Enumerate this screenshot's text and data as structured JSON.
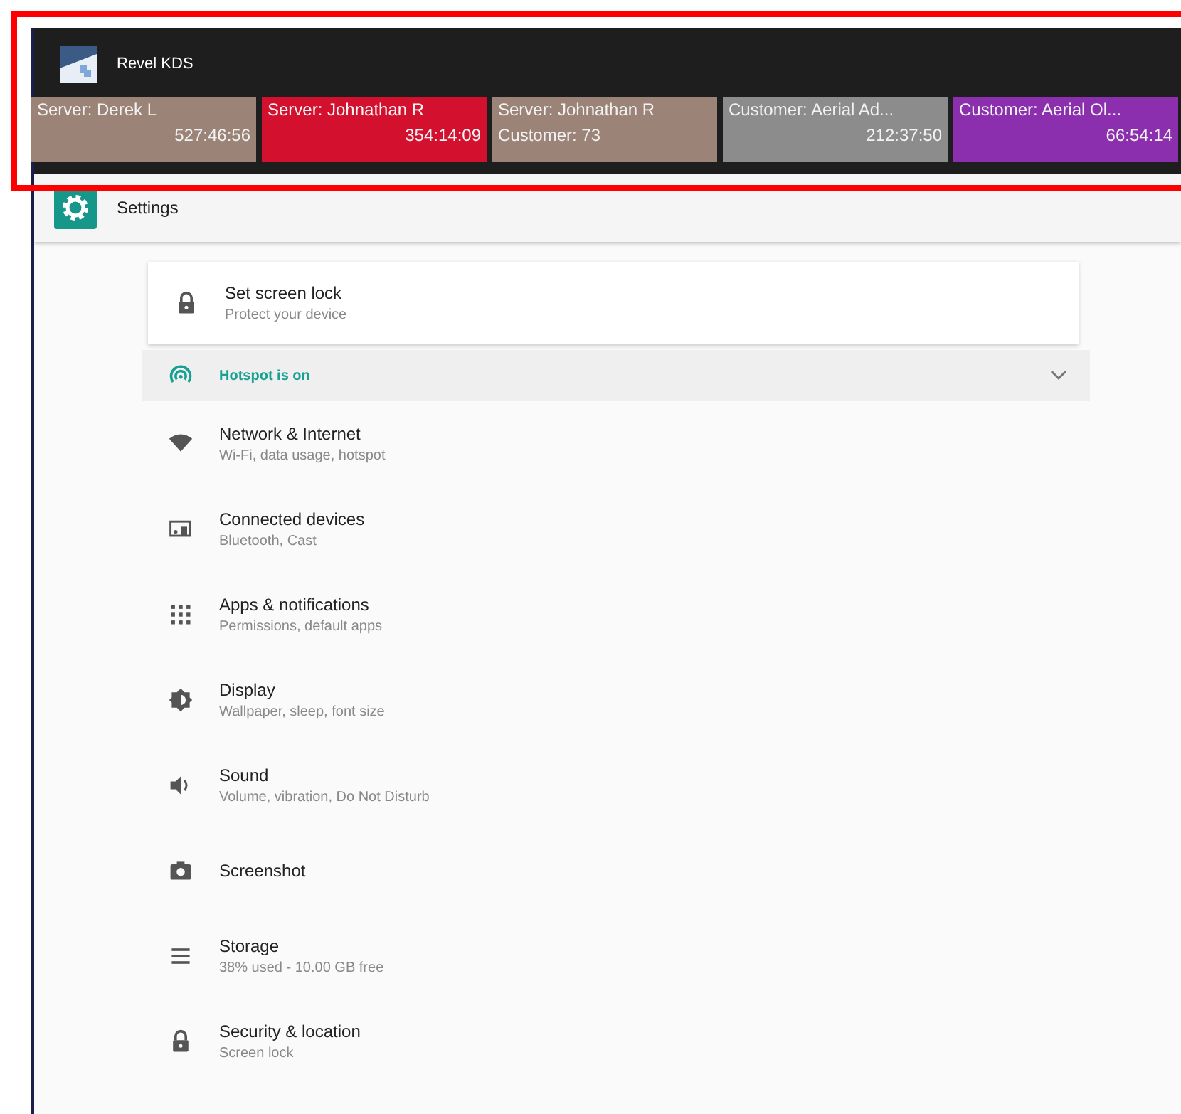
{
  "app_bar": {
    "title": "Revel KDS"
  },
  "tickets": [
    {
      "line_1": "Server: Derek L",
      "time": "527:46:56",
      "color": "#9b8378"
    },
    {
      "line_1": "Server: Johnathan R",
      "time": "354:14:09",
      "color": "#d3112f"
    },
    {
      "line_1": "Server: Johnathan R",
      "line_2": "Customer: 73",
      "color": "#9b8378"
    },
    {
      "line_1": "Customer: Aerial Ad...",
      "time": "212:37:50",
      "color": "#8c8c8c"
    },
    {
      "line_1": "Customer: Aerial Ol...",
      "time": "66:54:14",
      "color": "#8b2fae"
    }
  ],
  "settings": {
    "title": "Settings",
    "suggestion": {
      "title": "Set screen lock",
      "subtitle": "Protect your device"
    },
    "condition": {
      "label": "Hotspot is on",
      "expanded": false
    },
    "items": [
      {
        "kind": "wifi",
        "title": "Network & Internet",
        "subtitle": "Wi-Fi, data usage, hotspot"
      },
      {
        "kind": "devices",
        "title": "Connected devices",
        "subtitle": "Bluetooth, Cast"
      },
      {
        "kind": "apps",
        "title": "Apps & notifications",
        "subtitle": "Permissions, default apps"
      },
      {
        "kind": "display",
        "title": "Display",
        "subtitle": "Wallpaper, sleep, font size"
      },
      {
        "kind": "sound",
        "title": "Sound",
        "subtitle": "Volume, vibration, Do Not Disturb"
      },
      {
        "kind": "camera",
        "title": "Screenshot"
      },
      {
        "kind": "storage",
        "title": "Storage",
        "subtitle": "38% used - 10.00 GB free"
      },
      {
        "kind": "lock",
        "title": "Security & location",
        "subtitle": "Screen lock"
      }
    ]
  }
}
